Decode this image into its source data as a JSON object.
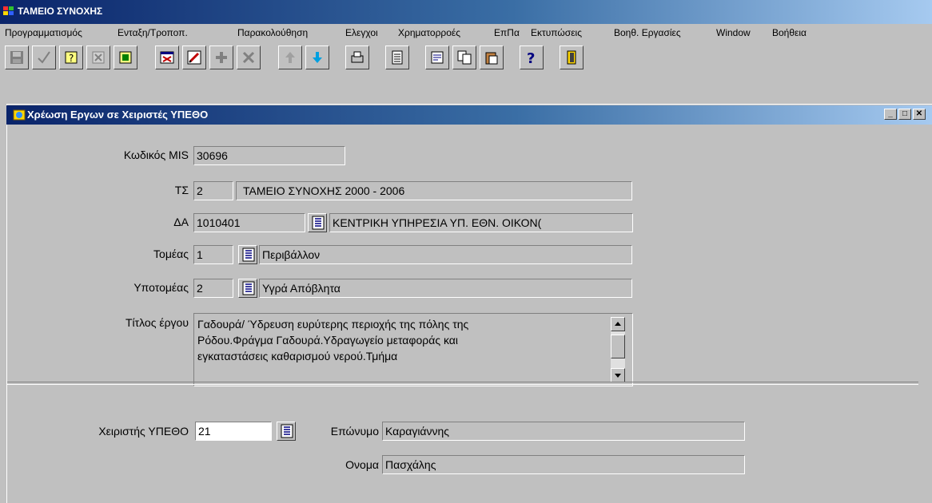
{
  "app": {
    "title": "ΤΑΜΕΙΟ ΣΥΝΟΧΗΣ",
    "title_color": "#0a246a",
    "menu": [
      "Προγραμματισμός",
      "Ενταξη/Τροποπ.",
      "Παρακολούθηση",
      "Ελεγχοι",
      "Χρηματορροές",
      "ΕπΠα",
      "Εκτυπώσεις",
      "Βοηθ. Εργασίες",
      "Window",
      "Βοήθεια"
    ]
  },
  "toolbar": {
    "icons": [
      "save-icon",
      "accept-icon",
      "query-icon",
      "cancel-query-icon",
      "execute-query-icon",
      "print-preview-icon",
      "edit-icon",
      "insert-record-icon",
      "delete-record-icon",
      "previous-record-icon",
      "next-record-icon",
      "print-icon",
      "list-icon",
      "notes-icon",
      "copy-icon",
      "paste-icon",
      "help-icon",
      "exit-icon"
    ]
  },
  "form": {
    "window_title": "Χρέωση Εργων σε Χειριστές ΥΠΕΘΟ",
    "mis": {
      "label": "Κωδικός MIS",
      "value": "30696"
    },
    "ts": {
      "label": "ΤΣ",
      "code": "2",
      "name": "ΤΑΜΕΙΟ ΣΥΝΟΧΗΣ 2000 - 2006"
    },
    "da": {
      "label": "ΔΑ",
      "code": "1010401",
      "name": "ΚΕΝΤΡΙΚΗ ΥΠΗΡΕΣΙΑ ΥΠ. ΕΘΝ. ΟΙΚΟΝ("
    },
    "sector": {
      "label": "Τομέας",
      "code": "1",
      "name": "Περιβάλλον"
    },
    "subsector": {
      "label": "Υποτομέας",
      "code": "2",
      "name": "Υγρά Απόβλητα"
    },
    "project_title": {
      "label": "Τίτλος έργου",
      "lines": [
        "Γαδουρά/ Ύδρευση ευρύτερης περιοχής της πόλης της",
        "Ρόδου.Φράγμα Γαδουρά.Υδραγωγείο μεταφοράς και",
        "εγκαταστάσεις καθαρισμού νερού.Τμήμα"
      ]
    },
    "handler": {
      "label": "Χειριστής ΥΠΕΘΟ",
      "code": "21",
      "surname_label": "Επώνυμο",
      "surname": "Καραγιάννης",
      "name_label": "Ονομα",
      "name": "Πασχάλης"
    }
  }
}
